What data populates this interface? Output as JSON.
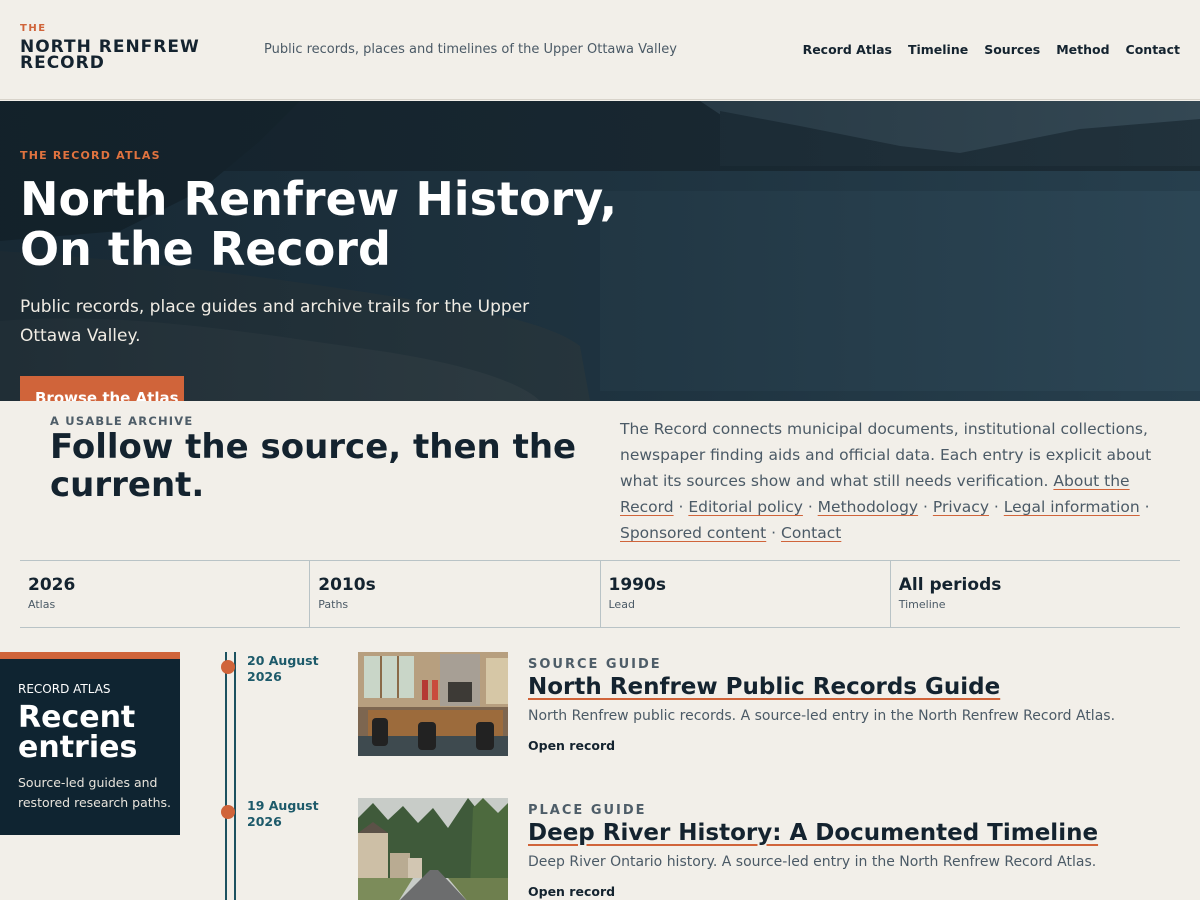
{
  "header": {
    "brand_kicker": "THE",
    "brand_name": "NORTH RENFREW RECORD",
    "tagline": "Public records, places and timelines of the Upper Ottawa Valley",
    "nav": [
      "Record Atlas",
      "Timeline",
      "Sources",
      "Method",
      "Contact"
    ]
  },
  "hero": {
    "kicker": "THE RECORD ATLAS",
    "title": "North Renfrew History, On the Record",
    "subtitle": "Public records, place guides and archive trails for the Upper Ottawa Valley.",
    "button_label": "Browse the Atlas"
  },
  "intro": {
    "kicker": "A USABLE ARCHIVE",
    "heading": "Follow the source, then the current.",
    "text": "The Record connects municipal documents, institutional collections, newspaper finding aids and official data. Each entry is explicit about what its sources show and what still needs verification.",
    "links": [
      "About the Record",
      "Editorial policy",
      "Methodology",
      "Privacy",
      "Legal information",
      "Sponsored content",
      "Contact"
    ],
    "separator": " · "
  },
  "stats": [
    {
      "value": "2026",
      "label": "Atlas"
    },
    {
      "value": "2010s",
      "label": "Paths"
    },
    {
      "value": "1990s",
      "label": "Lead"
    },
    {
      "value": "All periods",
      "label": "Timeline"
    }
  ],
  "sidebar": {
    "kicker": "RECORD ATLAS",
    "title": "Recent entries",
    "text": "Source-led guides and restored research paths."
  },
  "entries": [
    {
      "date": "20 August 2026",
      "kicker": "SOURCE GUIDE",
      "title": "North Renfrew Public Records Guide",
      "description": "North Renfrew public records. A source-led entry in the North Renfrew Record Atlas.",
      "link_label": "Open record",
      "thumb_icon": "council-chamber-photo"
    },
    {
      "date": "19 August 2026",
      "kicker": "PLACE GUIDE",
      "title": "Deep River History: A Documented Timeline",
      "description": "Deep River Ontario history. A source-led entry in the North Renfrew Record Atlas.",
      "link_label": "Open record",
      "thumb_icon": "street-photo"
    }
  ],
  "colors": {
    "accent": "#d0643a",
    "navy": "#0f2431",
    "teal": "#1d5260",
    "background": "#f2efe9"
  }
}
